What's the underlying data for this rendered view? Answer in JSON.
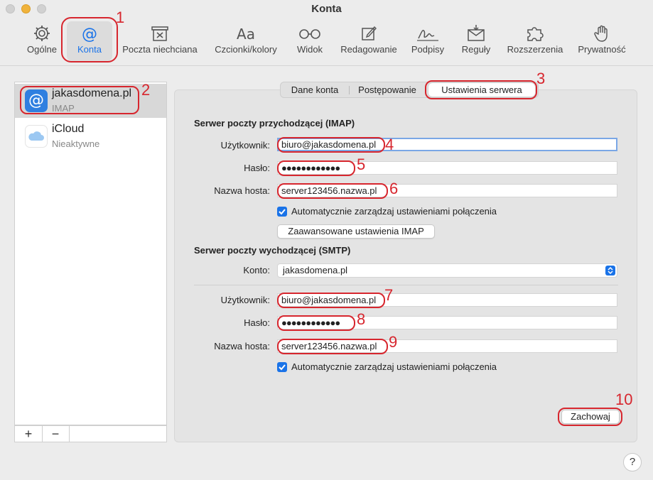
{
  "window": {
    "title": "Konta"
  },
  "toolbar": {
    "items": [
      {
        "label": "Ogólne",
        "icon": "gear-icon"
      },
      {
        "label": "Konta",
        "icon": "at-sign-icon"
      },
      {
        "label": "Poczta niechciana",
        "icon": "junk-bin-icon"
      },
      {
        "label": "Czcionki/kolory",
        "icon": "fonts-icon",
        "glyph": "Aa"
      },
      {
        "label": "Widok",
        "icon": "glasses-icon"
      },
      {
        "label": "Redagowanie",
        "icon": "compose-icon"
      },
      {
        "label": "Podpisy",
        "icon": "signature-icon"
      },
      {
        "label": "Reguły",
        "icon": "rules-envelope-icon"
      },
      {
        "label": "Rozszerzenia",
        "icon": "puzzle-icon"
      },
      {
        "label": "Prywatność",
        "icon": "hand-icon"
      }
    ]
  },
  "sidebar": {
    "accounts": [
      {
        "name": "jakasdomena.pl",
        "type": "IMAP",
        "icon": "at-sign-icon"
      },
      {
        "name": "iCloud",
        "type": "Nieaktywne",
        "icon": "cloud-icon"
      }
    ],
    "add_label": "+",
    "remove_label": "−"
  },
  "tabs": [
    "Dane konta",
    "Postępowanie",
    "Ustawienia serwera"
  ],
  "incoming": {
    "title": "Serwer poczty przychodzącej (IMAP)",
    "user_label": "Użytkownik:",
    "user_value": "biuro@jakasdomena.pl",
    "password_label": "Hasło:",
    "password_value": "●●●●●●●●●●●●",
    "host_label": "Nazwa hosta:",
    "host_value": "server123456.nazwa.pl",
    "auto_label": "Automatycznie zarządzaj ustawieniami połączenia",
    "advanced_button": "Zaawansowane ustawienia IMAP"
  },
  "outgoing": {
    "title": "Serwer poczty wychodzącej (SMTP)",
    "account_label": "Konto:",
    "account_value": "jakasdomena.pl",
    "user_label": "Użytkownik:",
    "user_value": "biuro@jakasdomena.pl",
    "password_label": "Hasło:",
    "password_value": "●●●●●●●●●●●●",
    "host_label": "Nazwa hosta:",
    "host_value": "server123456.nazwa.pl",
    "auto_label": "Automatycznie zarządzaj ustawieniami połączenia"
  },
  "save_button": "Zachowaj",
  "help_label": "?",
  "annotations": [
    "1",
    "2",
    "3",
    "4",
    "5",
    "6",
    "7",
    "8",
    "9",
    "10"
  ],
  "colors": {
    "accent": "#1a73e8",
    "annotation": "#d7262e"
  }
}
